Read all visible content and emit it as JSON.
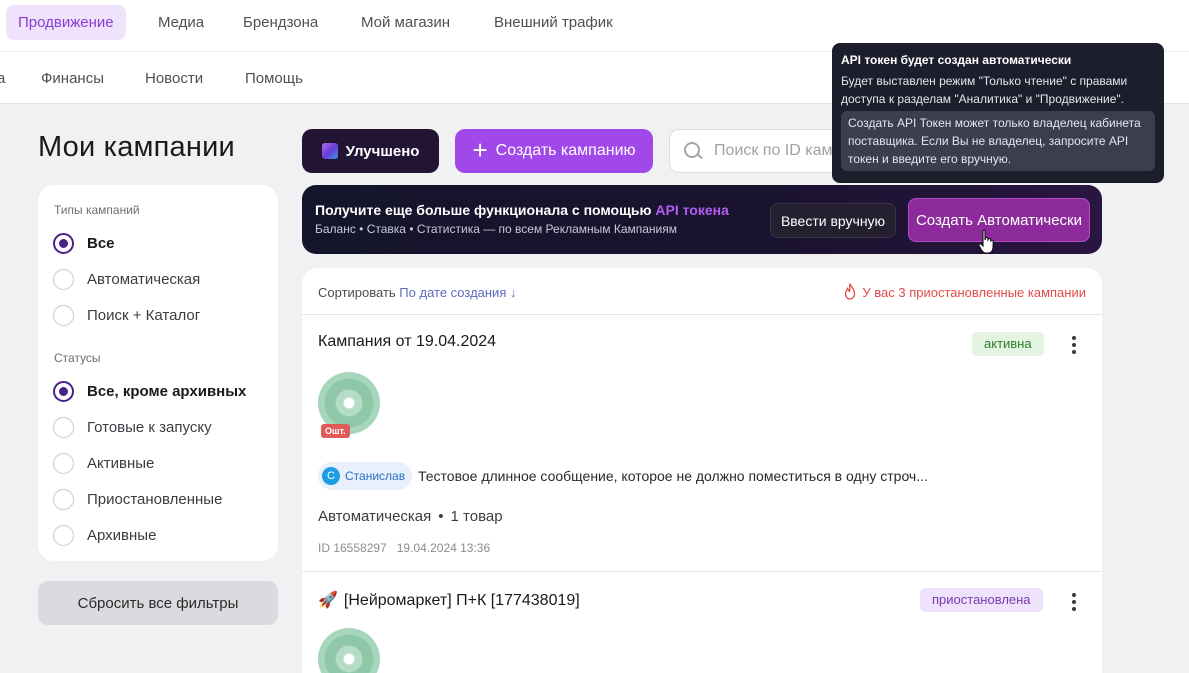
{
  "top_nav": {
    "items": [
      "Продвижение",
      "Медиа",
      "Брендзона",
      "Мой магазин",
      "Внешний трафик"
    ],
    "active": "Продвижение"
  },
  "sub_nav": {
    "partial": "а",
    "items": [
      "Финансы",
      "Новости",
      "Помощь"
    ]
  },
  "page": {
    "title": "Мои кампании"
  },
  "filters": {
    "types_title": "Типы кампаний",
    "types": [
      {
        "label": "Все",
        "checked": true
      },
      {
        "label": "Автоматическая",
        "checked": false
      },
      {
        "label": "Поиск + Каталог",
        "checked": false
      }
    ],
    "statuses_title": "Статусы",
    "statuses": [
      {
        "label": "Все, кроме архивных",
        "checked": true
      },
      {
        "label": "Готовые к запуску",
        "checked": false
      },
      {
        "label": "Активные",
        "checked": false
      },
      {
        "label": "Приостановленные",
        "checked": false
      },
      {
        "label": "Архивные",
        "checked": false
      }
    ],
    "reset_label": "Сбросить все фильтры"
  },
  "toolbar": {
    "improved_label": "Улучшено",
    "create_label": "Создать кампанию",
    "search_placeholder": "Поиск по ID кампании"
  },
  "banner": {
    "title_prefix": "Получите еще больше функционала с помощью ",
    "title_accent": "API токена",
    "subtitle": "Баланс  •  Ставка  •  Статистика — по всем Рекламным Кампаниям",
    "manual_label": "Ввести вручную",
    "auto_label": "Создать Автоматически"
  },
  "tooltip": {
    "title": "API токен будет создан автоматически",
    "text": "Будет выставлен режим \"Только чтение\" с правами доступа к разделам \"Аналитика\" и \"Продвижение\".",
    "note": "Создать API Токен может только владелец кабинета поставщика. Если Вы не владелец, запросите API токен и введите его вручную."
  },
  "list": {
    "sort_label": "Сортировать",
    "sort_value": "По дате создания ↓",
    "warning": "У вас 3 приостановленные кампании",
    "campaigns": [
      {
        "name": "Кампания от 19.04.2024",
        "status": "активна",
        "out_of_stock": "Ошт.",
        "author": "Станислав",
        "author_initial": "С",
        "message": "Тестовое длинное сообщение, которое не должно поместиться в одну строч...",
        "type": "Автоматическая",
        "items": "1 товар",
        "id": "ID 16558297",
        "date": "19.04.2024 13:36"
      },
      {
        "name": "[Нейромаркет] П+К [177438019]",
        "status": "приостановлена"
      }
    ]
  },
  "colors": {
    "accent": "#a148e8",
    "active_nav_bg": "#eee3fb",
    "warning": "#e14a4a",
    "banner_bg": "#14152b",
    "auto_btn": "#8e2b9c"
  }
}
